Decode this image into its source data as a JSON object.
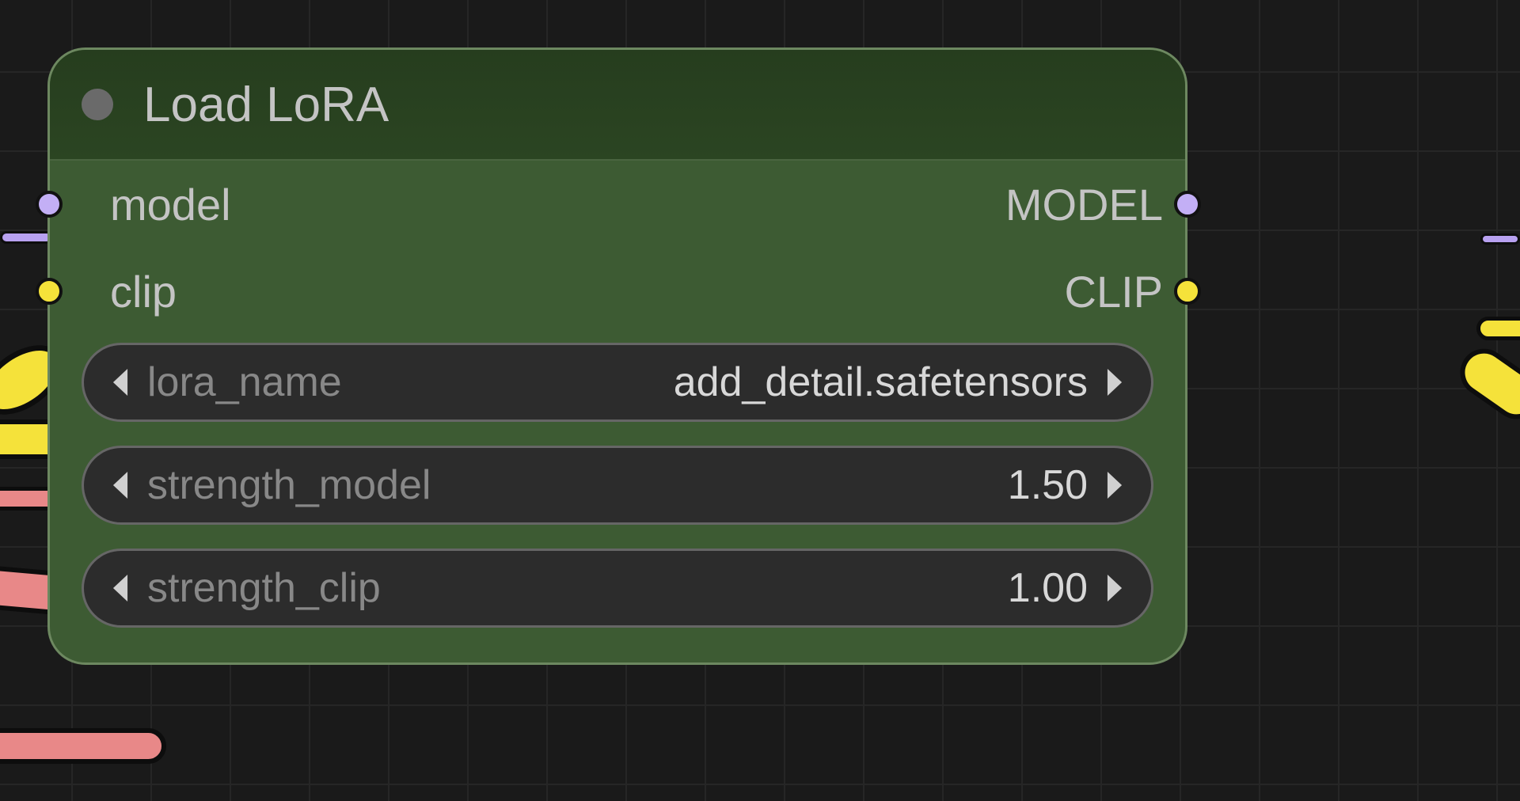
{
  "node": {
    "title": "Load LoRA",
    "inputs": [
      {
        "label": "model",
        "color": "purple"
      },
      {
        "label": "clip",
        "color": "yellow"
      }
    ],
    "outputs": [
      {
        "label": "MODEL",
        "color": "purple"
      },
      {
        "label": "CLIP",
        "color": "yellow"
      }
    ],
    "widgets": [
      {
        "label": "lora_name",
        "value": "add_detail.safetensors"
      },
      {
        "label": "strength_model",
        "value": "1.50"
      },
      {
        "label": "strength_clip",
        "value": "1.00"
      }
    ]
  },
  "colors": {
    "purple": "#c3aff5",
    "yellow": "#f5e23a"
  }
}
